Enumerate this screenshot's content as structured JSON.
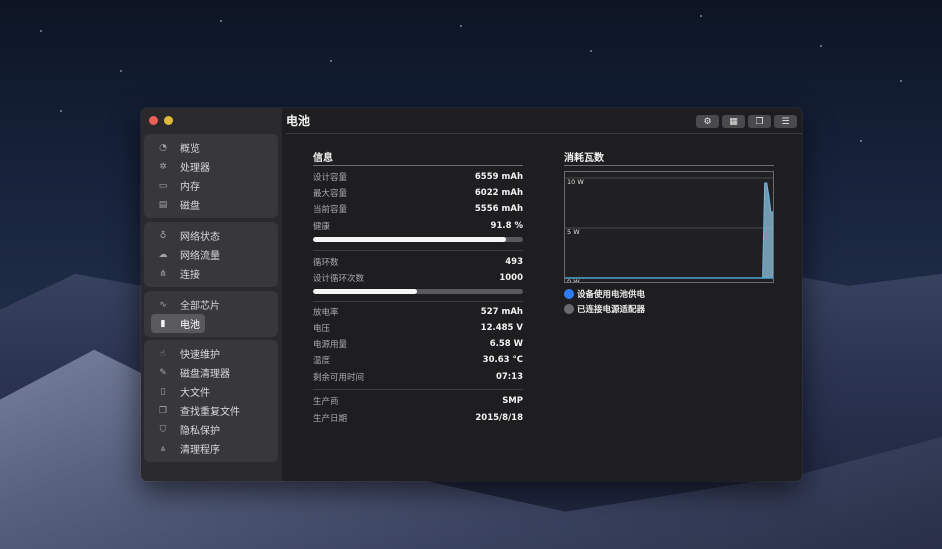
{
  "window": {
    "title": "电池"
  },
  "toolbar": {
    "buttons": [
      {
        "icon": "gear-icon",
        "glyph": "⚙"
      },
      {
        "icon": "grid-icon",
        "glyph": "▦"
      },
      {
        "icon": "windows-icon",
        "glyph": "❐"
      },
      {
        "icon": "list-icon",
        "glyph": "☰"
      }
    ]
  },
  "sidebar": {
    "groups": [
      [
        {
          "label": "概览",
          "icon": "gauge-icon",
          "glyph": "◔"
        },
        {
          "label": "处理器",
          "icon": "cpu-icon",
          "glyph": "✲"
        },
        {
          "label": "内存",
          "icon": "memory-icon",
          "glyph": "▭"
        },
        {
          "label": "磁盘",
          "icon": "disk-icon",
          "glyph": "▤"
        }
      ],
      [
        {
          "label": "网络状态",
          "icon": "network-icon",
          "glyph": "♁"
        },
        {
          "label": "网络流量",
          "icon": "cloud-icon",
          "glyph": "☁"
        },
        {
          "label": "连接",
          "icon": "connections-icon",
          "glyph": "⋔"
        }
      ],
      [
        {
          "label": "全部芯片",
          "icon": "pulse-icon",
          "glyph": "∿"
        },
        {
          "label": "电池",
          "icon": "battery-icon",
          "glyph": "▮",
          "active": true
        }
      ],
      [
        {
          "label": "快速维护",
          "icon": "hand-icon",
          "glyph": "☝"
        },
        {
          "label": "磁盘清理器",
          "icon": "broom-icon",
          "glyph": "✎"
        },
        {
          "label": "大文件",
          "icon": "file-icon",
          "glyph": "▯"
        },
        {
          "label": "查找重复文件",
          "icon": "duplicate-icon",
          "glyph": "❐"
        },
        {
          "label": "隐私保护",
          "icon": "shield-icon",
          "glyph": "⛉"
        },
        {
          "label": "清理程序",
          "icon": "apps-icon",
          "glyph": "⩓"
        }
      ]
    ]
  },
  "info": {
    "title": "信息",
    "design_capacity": {
      "label": "设计容量",
      "value": "6559 mAh"
    },
    "max_capacity": {
      "label": "最大容量",
      "value": "6022 mAh"
    },
    "current_capacity": {
      "label": "当前容量",
      "value": "5556 mAh"
    },
    "health": {
      "label": "健康",
      "value": "91.8 %",
      "fraction": 0.918
    },
    "cycle_count": {
      "label": "循环数",
      "value": "493"
    },
    "design_cycles": {
      "label": "设计循环次数",
      "value": "1000",
      "fraction": 0.493
    },
    "discharge_rate": {
      "label": "放电率",
      "value": "527 mAh"
    },
    "voltage": {
      "label": "电压",
      "value": "12.485 V"
    },
    "power_usage": {
      "label": "电源用量",
      "value": "6.58 W"
    },
    "temperature": {
      "label": "温度",
      "value": "30.63 °C"
    },
    "time_remaining": {
      "label": "剩余可用时间",
      "value": "07:13"
    },
    "manufacturer": {
      "label": "生产商",
      "value": "SMP"
    },
    "manufacture_date": {
      "label": "生产日期",
      "value": "2015/8/18"
    }
  },
  "consumption": {
    "title": "消耗瓦数",
    "legend": [
      {
        "label": "设备使用电池供电",
        "color": "#2e7cf6"
      },
      {
        "label": "已连接电源适配器",
        "color": "#6b6b6e"
      }
    ]
  },
  "chart_data": {
    "type": "area",
    "ylim": [
      0,
      10
    ],
    "yticks": [
      "10 W",
      "5 W",
      "0 W"
    ],
    "grid": true,
    "series": [
      {
        "values": [
          0,
          0,
          0,
          0,
          0,
          0,
          0,
          0,
          0,
          0,
          0,
          0,
          0,
          0,
          0,
          0,
          0,
          0,
          0,
          0,
          0,
          0,
          0,
          0,
          0,
          0,
          0,
          0,
          0,
          0,
          0,
          0,
          0,
          0,
          0,
          0,
          0,
          0,
          0,
          0,
          0,
          0,
          0,
          0,
          0,
          0,
          0,
          0,
          0,
          0,
          0,
          0,
          0,
          0,
          0,
          0,
          0,
          0,
          0,
          0,
          0,
          0,
          0,
          0,
          0,
          0,
          0,
          0,
          0,
          0,
          0,
          0,
          0,
          0,
          0,
          0,
          0,
          0,
          0,
          0,
          0,
          0,
          0,
          0,
          0,
          0,
          0,
          0,
          0,
          0,
          0,
          0,
          0,
          0,
          0,
          0,
          9.5,
          9.5,
          8.2,
          6.6,
          6.6
        ]
      }
    ],
    "colors": [
      "#8fc3de"
    ]
  }
}
